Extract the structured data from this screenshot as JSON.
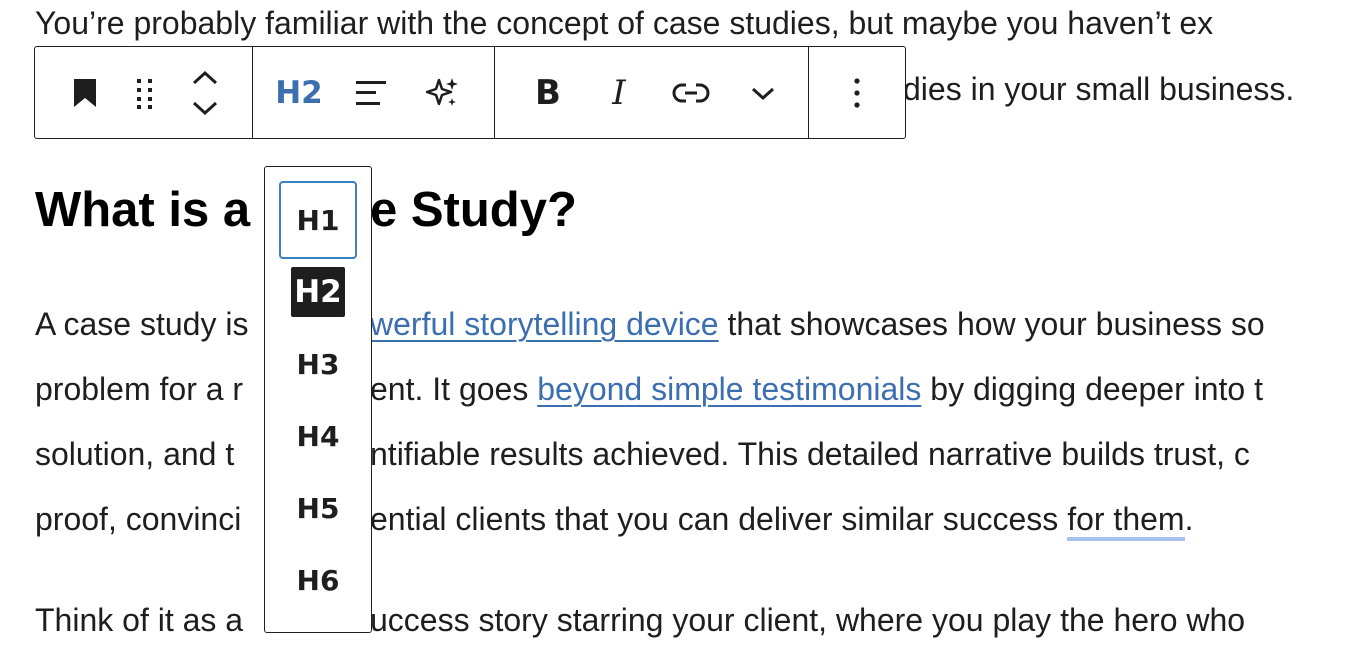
{
  "content": {
    "line1": "You’re probably familiar with the concept of case studies, but maybe you haven’t ex",
    "line2_tail": "dies in your small business.",
    "heading_left": "What is a",
    "heading_right": "e Study?",
    "p1": {
      "l1_a": "A case study is",
      "l1_link": "werful storytelling device",
      "l1_b": " that showcases how your business so",
      "l2_a": "problem for a r",
      "l2_b": "ent. It goes ",
      "l2_link": "beyond simple testimonials",
      "l2_c": " by digging deeper into t",
      "l3_a": "solution, and t",
      "l3_b": "ntifiable results achieved. This detailed narrative builds trust, c",
      "l4_a": "proof, convinci",
      "l4_b": "ential clients that you can deliver similar success ",
      "l4_mark": "for them",
      "l4_c": "."
    },
    "p2": {
      "a": "Think of it as a",
      "b": "uccess story starring your client, where you play the hero who"
    }
  },
  "toolbar": {
    "heading_level_label": "H2",
    "bold_label": "B",
    "italic_label": "I",
    "icons": {
      "block_type": "bookmark-icon",
      "drag": "drag-handle-icon",
      "move": "chevron-up-down-icon",
      "align": "align-left-icon",
      "ai": "sparkles-icon",
      "link": "link-icon",
      "more_format": "chevron-down-icon",
      "options": "more-vertical-icon"
    }
  },
  "heading_dropdown": {
    "items": [
      "H1",
      "H2",
      "H3",
      "H4",
      "H5",
      "H6"
    ],
    "selected": "H2",
    "focused": "H1"
  },
  "colors": {
    "link": "#3b6fb0",
    "accent": "#3b82c0",
    "grammar_underline": "#a8c1ee",
    "text": "#1e1e1e"
  }
}
